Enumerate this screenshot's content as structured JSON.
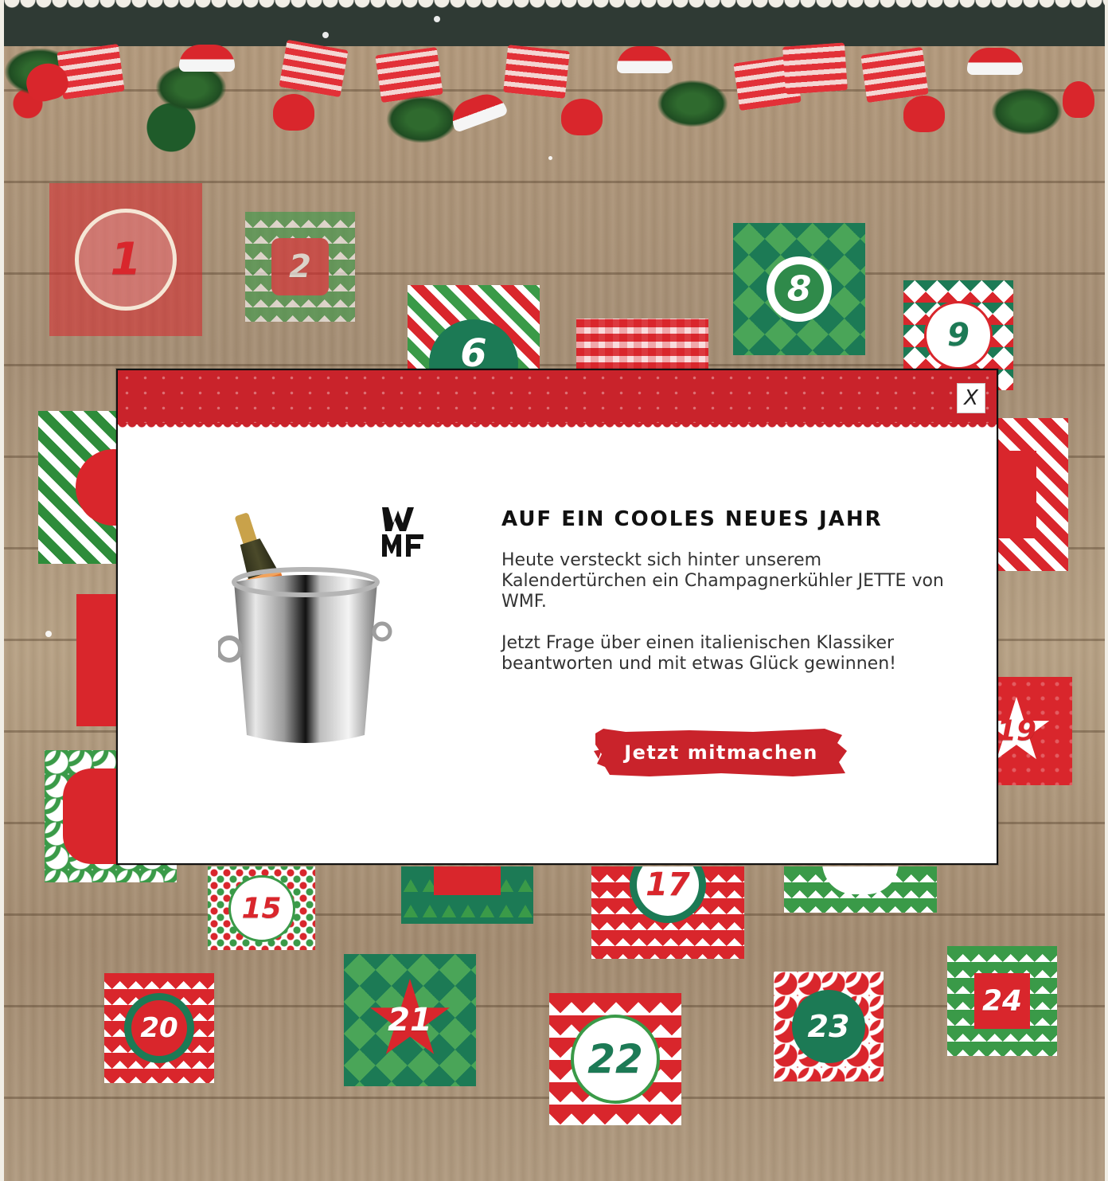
{
  "modal": {
    "close_label": "X",
    "title": "AUF EIN COOLES NEUES JAHR",
    "paragraph1": "Heute versteckt sich hinter unserem Kalendertürchen ein Champagnerkühler JETTE von WMF.",
    "paragraph2": "Jetzt Frage über einen italienischen Klassiker beantworten und mit etwas Glück gewinnen!",
    "cta_label": "Jetzt mitmachen",
    "brand": "WMF"
  },
  "calendar": {
    "doors": [
      "1",
      "2",
      "6",
      "8",
      "9",
      "15",
      "17",
      "19",
      "20",
      "21",
      "22",
      "23",
      "24"
    ]
  },
  "colors": {
    "red": "#d9262c",
    "green": "#3a9a48",
    "dark_green": "#1c7a55",
    "header_red": "#c9232b",
    "wood": "#b09a7f"
  }
}
